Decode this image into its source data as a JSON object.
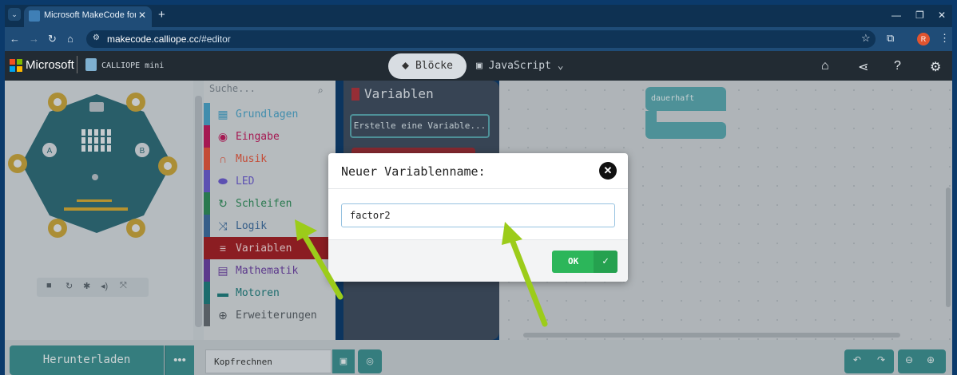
{
  "browser": {
    "tab_title": "Microsoft MakeCode for Calliope",
    "url_host": "makecode.calliope.cc",
    "url_path": "/#editor",
    "profile_initial": "R"
  },
  "menubar": {
    "brand": "Microsoft",
    "product": "CALLIOPE mini",
    "blocks_label": "Blöcke",
    "javascript_label": "JavaScript"
  },
  "toolbox": {
    "search_placeholder": "Suche...",
    "categories": [
      {
        "label": "Grundlagen",
        "color": "#4aa3c7",
        "icon": "grid-icon"
      },
      {
        "label": "Eingabe",
        "color": "#c2185b",
        "icon": "target-icon"
      },
      {
        "label": "Musik",
        "color": "#e6553a",
        "icon": "headphones-icon"
      },
      {
        "label": "LED",
        "color": "#6a5acd",
        "icon": "toggle-icon"
      },
      {
        "label": "Schleifen",
        "color": "#2e8b57",
        "icon": "loop-icon"
      },
      {
        "label": "Logik",
        "color": "#3d6b9c",
        "icon": "shuffle-icon"
      },
      {
        "label": "Variablen",
        "color": "#a31d22",
        "icon": "list-icon"
      },
      {
        "label": "Mathematik",
        "color": "#6b3fa0",
        "icon": "calculator-icon"
      },
      {
        "label": "Motoren",
        "color": "#1e7b7b",
        "icon": "car-icon"
      },
      {
        "label": "Erweiterungen",
        "color": "#666c72",
        "icon": "plus-circle-icon"
      }
    ]
  },
  "flyout": {
    "title": "Variablen",
    "make_variable": "Erstelle eine Variable..."
  },
  "workspace": {
    "forever_block": "dauerhaft"
  },
  "dialog": {
    "title": "Neuer Variablenname:",
    "input_value": "factor2",
    "ok_label": "OK"
  },
  "bottombar": {
    "download_label": "Herunterladen",
    "project_name": "Kopfrechnen"
  },
  "annotation_color": "#9ccc1a"
}
